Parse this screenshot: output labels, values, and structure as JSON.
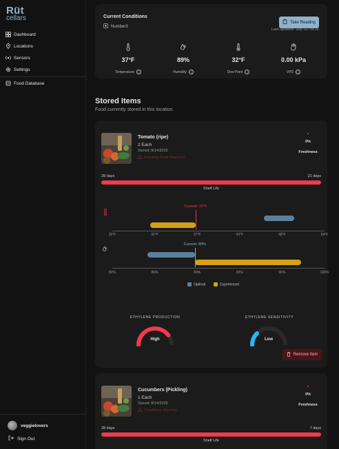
{
  "brand": {
    "line1": "Rüt",
    "line2": "cellars"
  },
  "sidebar": {
    "items": [
      {
        "label": "Dashboard",
        "icon": "dashboard-icon"
      },
      {
        "label": "Locations",
        "icon": "location-icon"
      },
      {
        "label": "Sensors",
        "icon": "sensor-icon"
      },
      {
        "label": "Settings",
        "icon": "gear-icon"
      },
      {
        "label": "Food Database",
        "icon": "database-icon"
      }
    ],
    "user": "veggielovers",
    "sign_out": "Sign Out"
  },
  "conditions": {
    "title": "Current Conditions",
    "sensor": "Number3",
    "take_reading": "Take Reading",
    "last_updated": "Last updated: Sep 10, 09:16",
    "metrics": [
      {
        "value": "37°F",
        "label": "Temperature",
        "icon": "thermometer-icon"
      },
      {
        "value": "89%",
        "label": "Humidity",
        "icon": "humidity-icon"
      },
      {
        "value": "32°F",
        "label": "Dew Point",
        "icon": "dew-point-icon"
      },
      {
        "value": "0.00 kPa",
        "label": "VPD",
        "icon": "vpd-icon"
      }
    ]
  },
  "stored": {
    "title": "Stored Items",
    "subtitle": "Food currently stored in this location."
  },
  "items": [
    {
      "name": "Tomato (ripe)",
      "qty": "2 Each",
      "stored": "Stored: 8/14/2025",
      "warning": "Freezing Point Reached",
      "freshness_value": "0%",
      "freshness_label": "Freshness",
      "freshness": 0,
      "shelf_left": "28 days",
      "shelf_right": "21 days",
      "shelf_label": "Shelf Life",
      "temp": {
        "current_label": "Current: 37°F",
        "current": 37,
        "min": 26,
        "max": 54,
        "ticks": [
          "26°F",
          "32°F",
          "37°F",
          "43°F",
          "48°F",
          "54°F"
        ],
        "optimal": [
          46,
          50
        ],
        "experienced": [
          31,
          37
        ]
      },
      "humidity": {
        "current_label": "Current: 89%",
        "current": 89,
        "min": 82,
        "max": 100,
        "ticks": [
          "82%",
          "86%",
          "89%",
          "93%",
          "96%",
          "100%"
        ],
        "optimal": [
          85,
          89
        ],
        "experienced": [
          89,
          98
        ]
      },
      "legend": {
        "optimal": "Optimal",
        "experienced": "Experienced"
      },
      "ethylene_production": {
        "title": "ETHYLENE PRODUCTION",
        "value": "High",
        "level": 0.8
      },
      "ethylene_sensitivity": {
        "title": "ETHYLENE SENSITIVITY",
        "value": "Low",
        "level": 0.25
      },
      "remove": "Remove Item"
    },
    {
      "name": "Cucumbers (Pickling)",
      "qty": "1 Each",
      "stored": "Stored: 8/14/2025",
      "warning": "Conditions Warning",
      "freshness_value": "0%",
      "freshness_label": "Freshness",
      "freshness": 0,
      "shelf_left": "28 days",
      "shelf_right": "7 days",
      "shelf_label": "Shelf Life"
    }
  ],
  "colors": {
    "accent": "#8fb1cc",
    "danger": "#ef3b4a",
    "optimal": "#5d7f9c",
    "experienced": "#d4a017",
    "sensitivity": "#29b6f6"
  }
}
